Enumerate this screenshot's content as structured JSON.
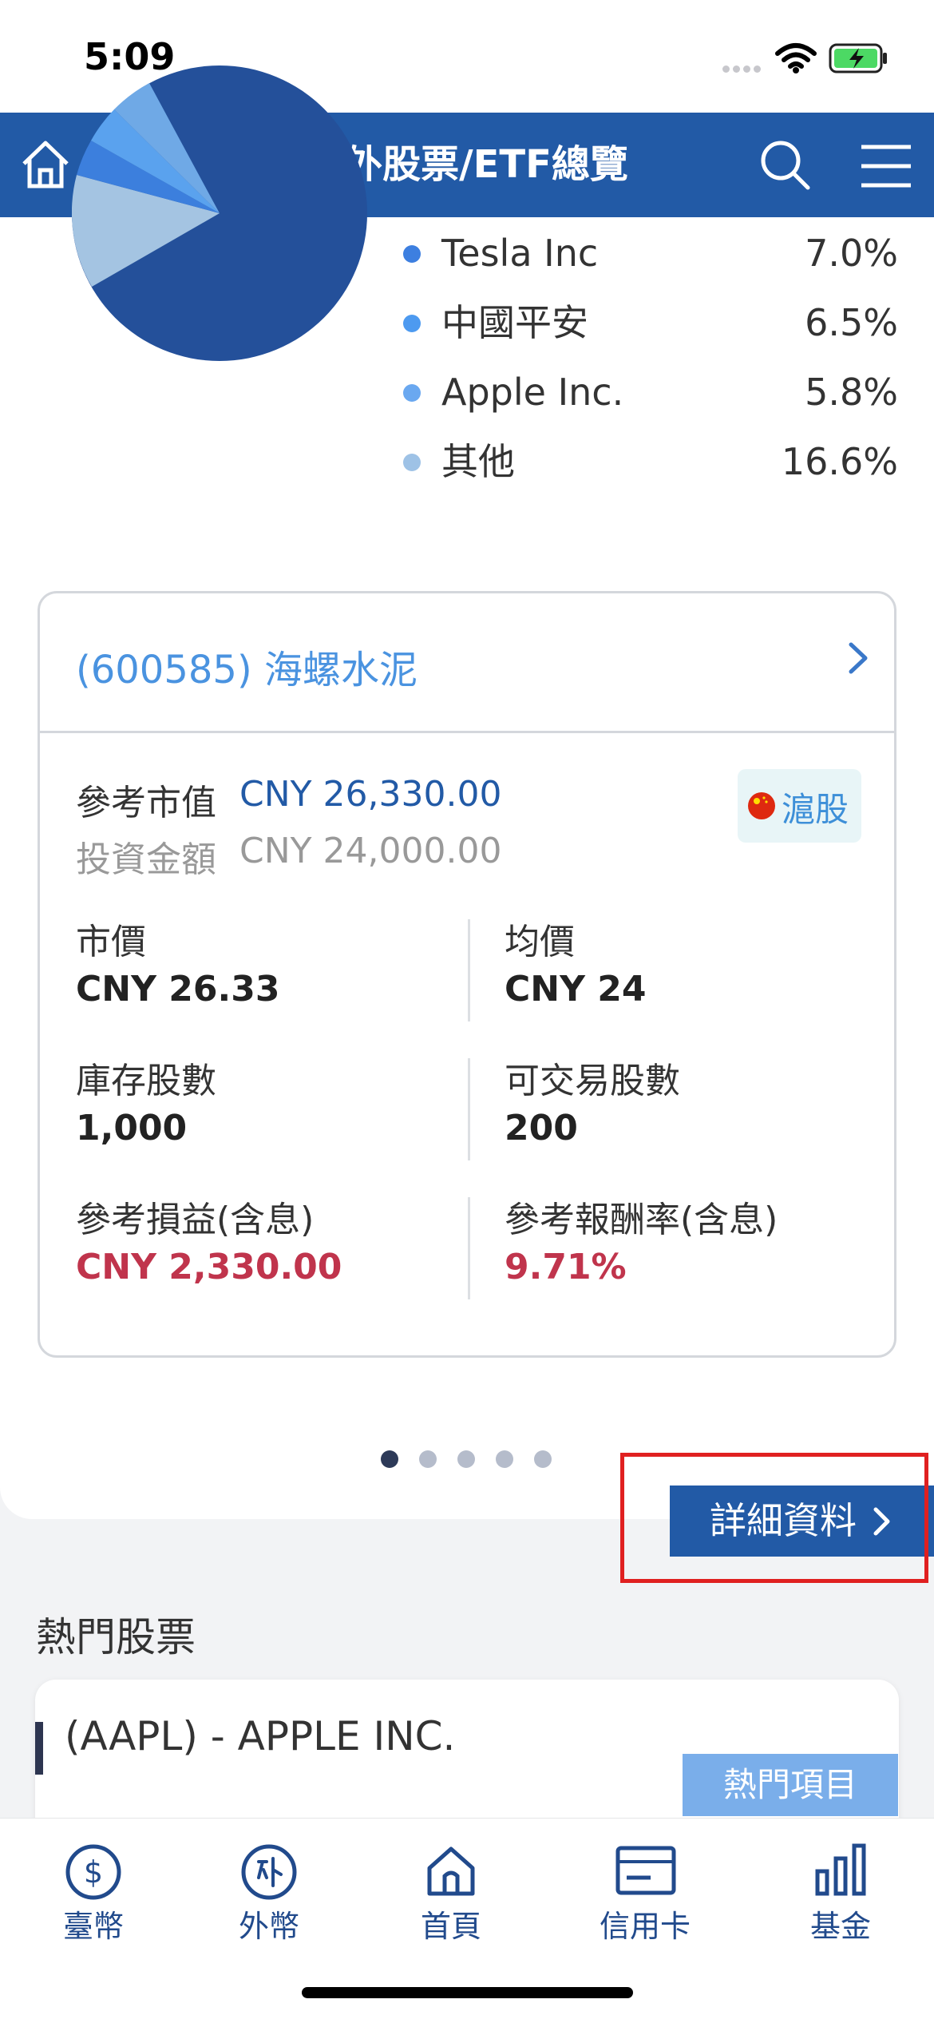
{
  "status_bar": {
    "time": "5:09"
  },
  "nav": {
    "title": "境外股票/ETF總覽",
    "home_icon": "home-icon",
    "search_icon": "search-icon",
    "menu_icon": "menu-icon"
  },
  "allocation": {
    "legend": [
      {
        "name": "Tesla Inc",
        "percent": "7.0%",
        "color": "#3d7fe0"
      },
      {
        "name": "中國平安",
        "percent": "6.5%",
        "color": "#4d9af0"
      },
      {
        "name": "Apple Inc.",
        "percent": "5.8%",
        "color": "#6aa8f0"
      },
      {
        "name": "其他",
        "percent": "16.6%",
        "color": "#9ec2e6"
      }
    ]
  },
  "holding": {
    "title": "(600585) 海螺水泥",
    "market_value_label": "參考市值",
    "market_value": "CNY 26,330.00",
    "invest_label": "投資金額",
    "invest_value": "CNY 24,000.00",
    "market_badge": "滬股",
    "price_label": "市價",
    "price_value": "CNY 26.33",
    "avg_label": "均價",
    "avg_value": "CNY 24",
    "shares_label": "庫存股數",
    "shares_value": "1,000",
    "tradable_label": "可交易股數",
    "tradable_value": "200",
    "pnl_label": "參考損益(含息)",
    "pnl_value": "CNY 2,330.00",
    "return_label": "參考報酬率(含息)",
    "return_value": "9.71%"
  },
  "pager": {
    "count": 5,
    "active": 0
  },
  "detail_button": {
    "label": "詳細資料"
  },
  "hot_stocks": {
    "title": "熱門股票",
    "first_item": {
      "name": "(AAPL) - APPLE INC.",
      "tag": "熱門項目"
    }
  },
  "tabbar": {
    "items": [
      {
        "label": "臺幣",
        "icon": "dollar-icon"
      },
      {
        "label": "外幣",
        "icon": "foreign-currency-icon"
      },
      {
        "label": "首頁",
        "icon": "home-icon"
      },
      {
        "label": "信用卡",
        "icon": "credit-card-icon"
      },
      {
        "label": "基金",
        "icon": "bar-chart-icon"
      }
    ]
  },
  "colors": {
    "primary": "#225aa6",
    "accent_light": "#4a93e0",
    "loss_red": "#c0344c",
    "highlight": "#e02020"
  }
}
